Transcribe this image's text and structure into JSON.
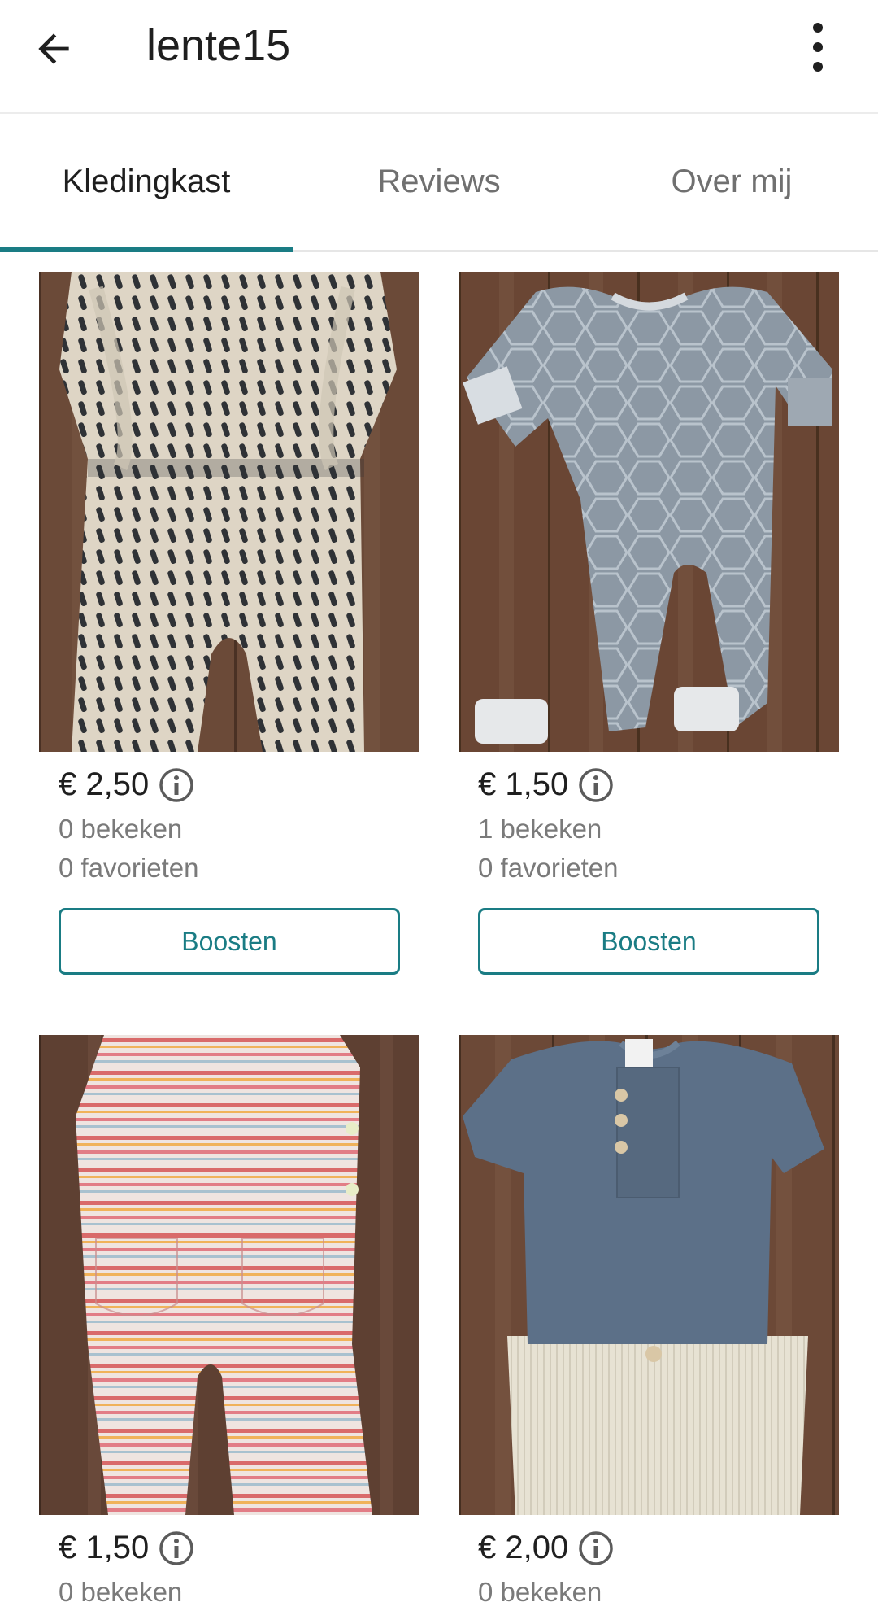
{
  "header": {
    "title": "lente15",
    "back_icon": "arrow-left-icon",
    "menu_icon": "more-vertical-icon"
  },
  "tabs": [
    {
      "label": "Kledingkast",
      "active": true
    },
    {
      "label": "Reviews",
      "active": false
    },
    {
      "label": "Over mij",
      "active": false
    }
  ],
  "colors": {
    "accent": "#1a7c84",
    "muted_text": "#7a7a7a"
  },
  "items": [
    {
      "price": "€ 2,50",
      "views": "0 bekeken",
      "favorites": "0 favorieten",
      "boost_label": "Boosten",
      "image": "patterned-jumpsuit"
    },
    {
      "price": "€ 1,50",
      "views": "1 bekeken",
      "favorites": "0 favorieten",
      "boost_label": "Boosten",
      "image": "grey-hexagon-onesie"
    },
    {
      "price": "€ 1,50",
      "views": "0 bekeken",
      "image": "striped-dungarees"
    },
    {
      "price": "€ 2,00",
      "views": "0 bekeken",
      "image": "blue-shirt-and-cream-pants"
    }
  ]
}
